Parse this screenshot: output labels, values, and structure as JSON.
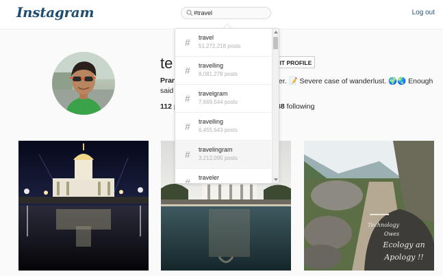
{
  "header": {
    "logo": "Instagram",
    "search_value": "#travel",
    "logout_label": "Log out"
  },
  "profile": {
    "username": "te",
    "edit_label": "EDIT PROFILE",
    "bio_name": "Pran",
    "bio_text": "ter. 📝 Severe case of wanderlust. 🌍🌏 Enough",
    "bio_cont": "said",
    "posts_count": "112",
    "posts_label": "p",
    "following_count": "38",
    "following_label": "following"
  },
  "search_results": [
    {
      "tag": "travel",
      "count": "51,272,218 posts"
    },
    {
      "tag": "travelling",
      "count": "8,081,278 posts"
    },
    {
      "tag": "travelgram",
      "count": "7,669,544 posts"
    },
    {
      "tag": "travelling",
      "count": "6,455,643 posts"
    },
    {
      "tag": "travelingram",
      "count": "3,212,095 posts"
    },
    {
      "tag": "traveler",
      "count": ""
    }
  ],
  "photos": [
    {
      "name": "temple-night-photo"
    },
    {
      "name": "palace-lake-photo"
    },
    {
      "name": "mountain-trail-photo",
      "rock_text": [
        "Technology",
        "Owes",
        "Ecology an",
        "Apology !!"
      ]
    }
  ],
  "colors": {
    "brand": "#1f4d72",
    "background": "#fafafa"
  }
}
